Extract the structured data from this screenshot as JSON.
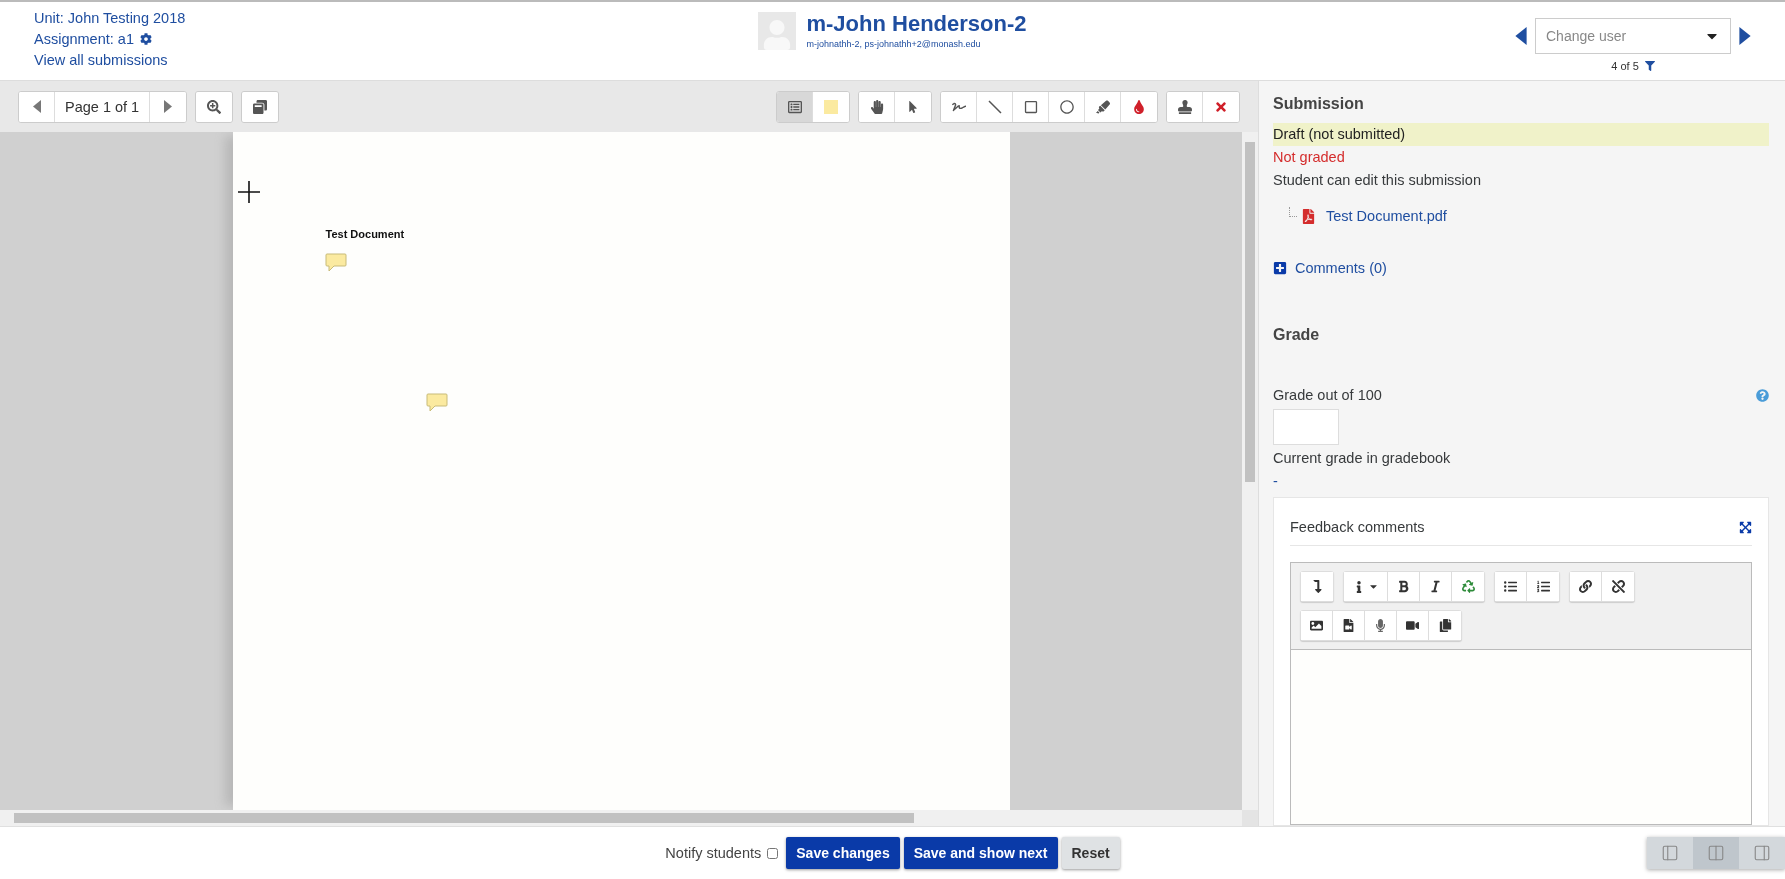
{
  "header": {
    "unit": "Unit: John Testing 2018",
    "assignment": "Assignment: a1",
    "view_all": "View all submissions",
    "user_name": "m-John Henderson-2",
    "user_email": "m-johnathh-2, ps-johnathh+2@monash.edu",
    "change_user": {
      "placeholder": "Change user"
    },
    "count": "4 of 5"
  },
  "pdf_toolbar": {
    "page": "Page 1 of 1"
  },
  "document": {
    "title": "Test Document"
  },
  "submission": {
    "heading": "Submission",
    "status": "Draft (not submitted)",
    "grading": "Not graded",
    "edit_note": "Student can edit this submission",
    "file": "Test Document.pdf",
    "comments": "Comments (0)"
  },
  "grade": {
    "heading": "Grade",
    "label": "Grade out of 100",
    "current_label": "Current grade in gradebook",
    "current_value": "-",
    "feedback_label": "Feedback comments"
  },
  "footer": {
    "notify": {
      "label": "Notify students",
      "checked": false
    },
    "buttons": [
      {
        "label": "Save changes",
        "kind": "primary"
      },
      {
        "label": "Save and show next",
        "kind": "primary"
      },
      {
        "label": "Reset",
        "kind": "secondary"
      }
    ],
    "layout_modes": [
      {
        "selected": false
      },
      {
        "selected": true
      },
      {
        "selected": false
      }
    ]
  }
}
